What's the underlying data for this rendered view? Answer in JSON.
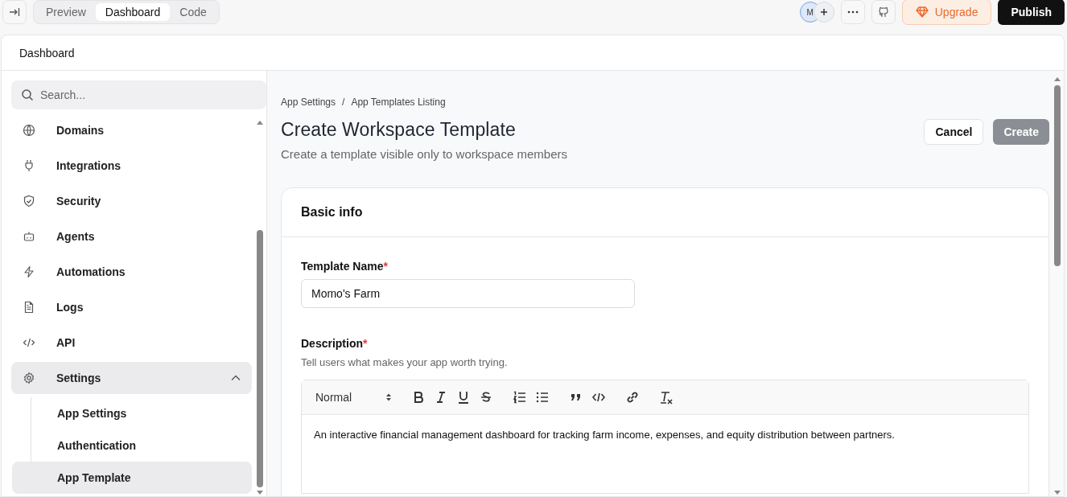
{
  "topbar": {
    "avatar_initial": "M",
    "view_tabs": [
      {
        "label": "Preview",
        "selected": false
      },
      {
        "label": "Dashboard",
        "selected": true
      },
      {
        "label": "Code",
        "selected": false
      }
    ],
    "upgrade": "Upgrade",
    "publish": "Publish"
  },
  "panel": {
    "title": "Dashboard"
  },
  "sidebar": {
    "search": {
      "placeholder": "Search..."
    },
    "items": [
      {
        "label": "Domains",
        "selected": false
      },
      {
        "label": "Integrations",
        "selected": false
      },
      {
        "label": "Security",
        "selected": false
      },
      {
        "label": "Agents",
        "selected": false
      },
      {
        "label": "Automations",
        "selected": false
      },
      {
        "label": "Logs",
        "selected": false
      },
      {
        "label": "API",
        "selected": false
      },
      {
        "label": "Settings",
        "selected": false,
        "expanded": true,
        "children": [
          {
            "label": "App Settings",
            "selected": false
          },
          {
            "label": "Authentication",
            "selected": false
          },
          {
            "label": "App Template",
            "selected": true
          }
        ]
      }
    ]
  },
  "main": {
    "breadcrumb": [
      "App Settings",
      "App Templates Listing"
    ],
    "breadcrumb_separator": "/",
    "required_mark": "*",
    "title": "Create Workspace Template",
    "subtitle": "Create a template visible only to workspace members",
    "buttons": [
      {
        "label": "Cancel",
        "kind": "secondary",
        "disabled": false
      },
      {
        "label": "Create",
        "kind": "primary",
        "disabled": true
      }
    ],
    "section_title": "Basic info",
    "fields": [
      {
        "kind": "text",
        "label": "Template Name",
        "required": true,
        "value": "Momo's Farm"
      },
      {
        "kind": "rich",
        "label": "Description",
        "required": true,
        "hint": "Tell users what makes your app worth trying.",
        "format": "Normal",
        "value": "An interactive financial management dashboard for tracking farm income, expenses, and equity distribution between partners."
      }
    ]
  }
}
